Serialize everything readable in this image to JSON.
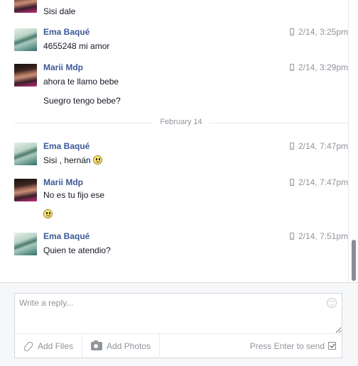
{
  "messages": [
    {
      "sender": "",
      "avatar": "marii",
      "time": "",
      "texts": [
        "Sisi dale"
      ],
      "partial": true
    },
    {
      "sender": "Ema Baqué",
      "avatar": "ema",
      "time": "2/14, 3:25pm",
      "texts": [
        "4655248 mi amor"
      ]
    },
    {
      "sender": "Marii Mdp",
      "avatar": "marii",
      "time": "2/14, 3:29pm",
      "texts": [
        "ahora te llamo bebe",
        "Suegro tengo bebe?"
      ]
    },
    {
      "sender": "Ema Baqué",
      "avatar": "ema",
      "time": "2/14, 7:47pm",
      "texts": [
        "Sisi , hernán"
      ]
    },
    {
      "sender": "Marii Mdp",
      "avatar": "marii",
      "time": "2/14, 7:47pm",
      "texts": [
        "No es tu fijo ese"
      ]
    },
    {
      "sender": "Ema Baqué",
      "avatar": "ema",
      "time": "2/14, 7:51pm",
      "texts": [
        "Quien te atendio?"
      ]
    }
  ],
  "divider": {
    "label": "February 14"
  },
  "composer": {
    "placeholder": "Write a reply...",
    "add_files_label": "Add Files",
    "add_photos_label": "Add Photos",
    "enter_to_send_label": "Press Enter to send",
    "enter_to_send_checked": true
  },
  "colors": {
    "sender": "#3b5998",
    "meta": "#90949c",
    "text": "#141823"
  }
}
